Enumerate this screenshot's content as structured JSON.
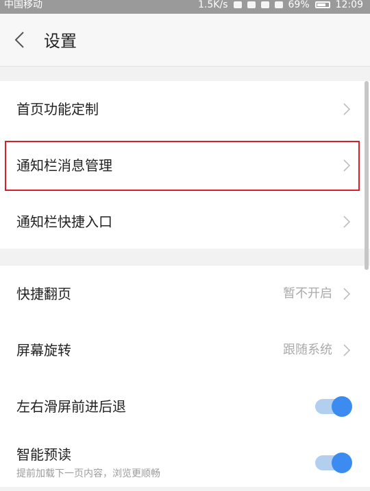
{
  "status_bar": {
    "carrier": "中国移动",
    "speed": "1.5K/s",
    "battery": "69%",
    "time": "12:09"
  },
  "nav": {
    "title": "设置"
  },
  "settings": {
    "homepage_customize": {
      "label": "首页功能定制"
    },
    "notification_message_mgmt": {
      "label": "通知栏消息管理"
    },
    "notification_shortcut": {
      "label": "通知栏快捷入口"
    },
    "quick_page_turn": {
      "label": "快捷翻页",
      "value": "暂不开启"
    },
    "screen_rotation": {
      "label": "屏幕旋转",
      "value": "跟随系统"
    },
    "swipe_nav": {
      "label": "左右滑屏前进后退",
      "enabled": true
    },
    "smart_preread": {
      "label": "智能预读",
      "sublabel": "提前加载下一页内容，浏览更顺畅",
      "enabled": true
    }
  },
  "colors": {
    "highlight": "#d81e2a",
    "toggle_on": "#3b8bf1",
    "toggle_track": "#b3cff0"
  }
}
